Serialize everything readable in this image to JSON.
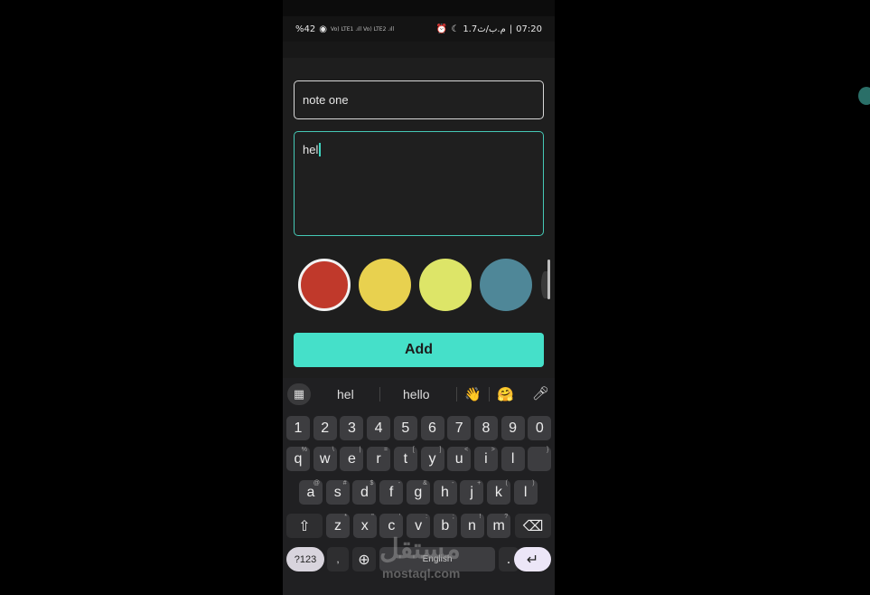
{
  "statusbar": {
    "battery": "%42",
    "net": "Vo) LTE1 .ıll Vo) LTE2 .ıll",
    "speed": "1.7م.ب/ث",
    "time": "07:20",
    "divider": "|"
  },
  "form": {
    "title_value": "note one",
    "body_value": "hel"
  },
  "colors": [
    "#c0392b",
    "#e8d14f",
    "#dde568",
    "#4f8798"
  ],
  "add_label": "Add",
  "keyboard": {
    "suggestions": [
      "hel",
      "hello"
    ],
    "emoji": [
      "👋",
      "🤗"
    ],
    "row_numbers": [
      "1",
      "2",
      "3",
      "4",
      "5",
      "6",
      "7",
      "8",
      "9",
      "0"
    ],
    "row_q": [
      {
        "k": "q",
        "h": "%"
      },
      {
        "k": "w",
        "h": "\\"
      },
      {
        "k": "e",
        "h": "|"
      },
      {
        "k": "r",
        "h": "="
      },
      {
        "k": "t",
        "h": "["
      },
      {
        "k": "y",
        "h": "]"
      },
      {
        "k": "u",
        "h": "<"
      },
      {
        "k": "i",
        "h": ">"
      },
      {
        "k": "l",
        "h": ""
      },
      {
        "k": "",
        "h": "}"
      }
    ],
    "row_a": [
      {
        "k": "a",
        "h": "@"
      },
      {
        "k": "s",
        "h": "#"
      },
      {
        "k": "d",
        "h": "$"
      },
      {
        "k": "f",
        "h": "-"
      },
      {
        "k": "g",
        "h": "&"
      },
      {
        "k": "h",
        "h": "-"
      },
      {
        "k": "j",
        "h": "+"
      },
      {
        "k": "k",
        "h": "("
      },
      {
        "k": "l",
        "h": ")"
      }
    ],
    "row_z": [
      {
        "k": "z",
        "h": "*"
      },
      {
        "k": "x",
        "h": "\""
      },
      {
        "k": "c",
        "h": "'"
      },
      {
        "k": "v",
        "h": ":"
      },
      {
        "k": "b",
        "h": ";"
      },
      {
        "k": "n",
        "h": "!"
      },
      {
        "k": "m",
        "h": "?"
      }
    ],
    "sym_label": "?123",
    "comma_label": ",",
    "space_label": "English",
    "period_label": ".",
    "shift_icon": "shift-icon",
    "backspace_icon": "backspace-icon",
    "enter_icon": "enter-icon",
    "globe_icon": "globe-icon"
  },
  "watermark": {
    "arabic": "مستقل",
    "latin": "mostaql.com"
  }
}
